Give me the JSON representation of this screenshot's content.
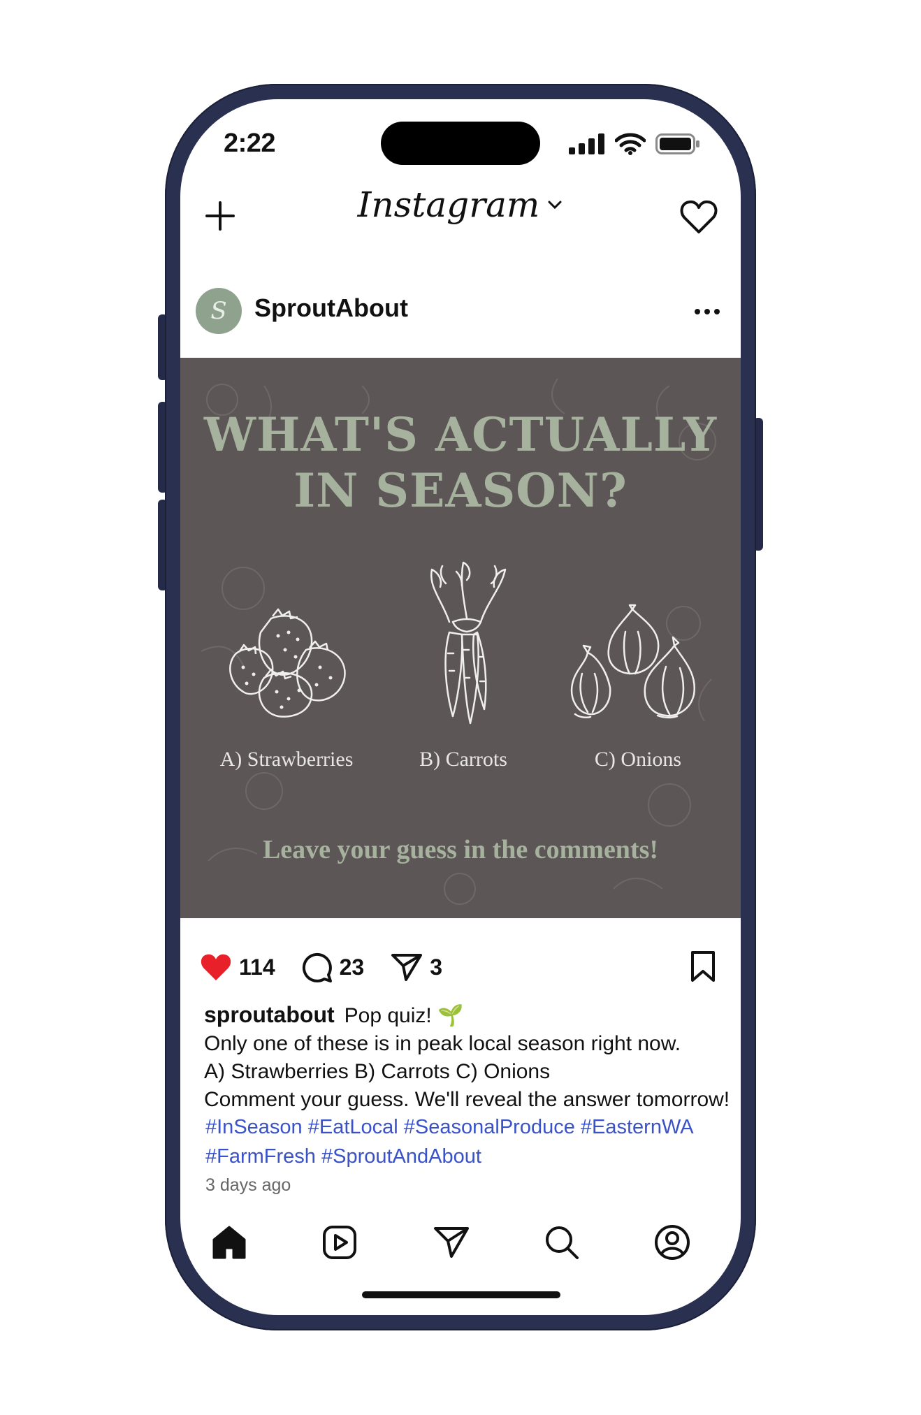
{
  "status_bar": {
    "time": "2:22"
  },
  "header": {
    "app_name": "Instagram"
  },
  "post": {
    "username": "SproutAbout",
    "avatar_letter": "S",
    "image": {
      "title_line1": "WHAT'S ACTUALLY",
      "title_line2": "IN SEASON?",
      "option_a": "A) Strawberries",
      "option_b": "B) Carrots",
      "option_c": "C) Onions",
      "cta": "Leave your guess in the comments!"
    },
    "actions": {
      "likes": "114",
      "comments": "23",
      "shares": "3"
    },
    "caption": {
      "username": "sproutabout",
      "line1": "Pop quiz! 🌱",
      "line2": "Only one of these is in peak local season right now.",
      "line3": "A) Strawberries B) Carrots C) Onions",
      "line4": "Comment your guess. We'll reveal the answer tomorrow!"
    },
    "hashtags_line1": "#InSeason #EatLocal #SeasonalProduce #EasternWA",
    "hashtags_line2": "#FarmFresh #SproutAndAbout",
    "time_ago": "3 days ago"
  },
  "colors": {
    "frame": "#2a3050",
    "image_bg": "#5c5756",
    "title_green": "#a6b29e",
    "like_red": "#e8202a",
    "hashtag_blue": "#3a52c8"
  },
  "bottom_nav": [
    "home-icon",
    "reels-icon",
    "send-icon",
    "search-icon",
    "profile-icon"
  ]
}
